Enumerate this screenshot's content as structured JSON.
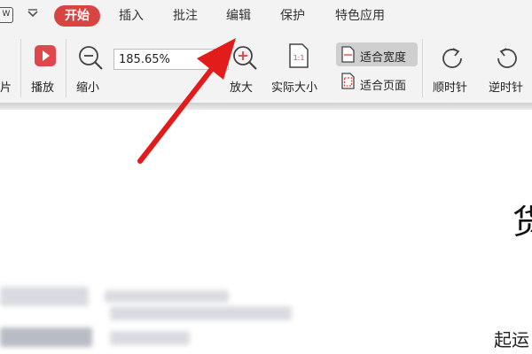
{
  "menu": {
    "tabs": [
      "开始",
      "插入",
      "批注",
      "编辑",
      "保护",
      "特色应用"
    ],
    "active_tab": "开始",
    "app_icon_glyph": "W"
  },
  "ribbon": {
    "partial_label": "片",
    "play_label": "播放",
    "zoom_out_label": "缩小",
    "zoom_value": "185.65%",
    "zoom_in_label": "放大",
    "actual_size_label": "实际大小",
    "actual_size_icon_text": "1:1",
    "fit_width_label": "适合宽度",
    "fit_page_label": "适合页面",
    "rotate_cw_label": "顺时针",
    "rotate_ccw_label": "逆时针"
  },
  "document": {
    "title_partial": "货",
    "text_partial": "起运"
  },
  "colors": {
    "active_tab": "#d64541",
    "play_icon": "#e0474c",
    "arrow": "#e21b1b"
  },
  "icons": [
    "app-icon",
    "dropdown-icon",
    "play-icon",
    "zoom-out-icon",
    "zoom-in-icon",
    "actual-size-icon",
    "fit-width-icon",
    "fit-page-icon",
    "rotate-cw-icon",
    "rotate-ccw-icon"
  ]
}
